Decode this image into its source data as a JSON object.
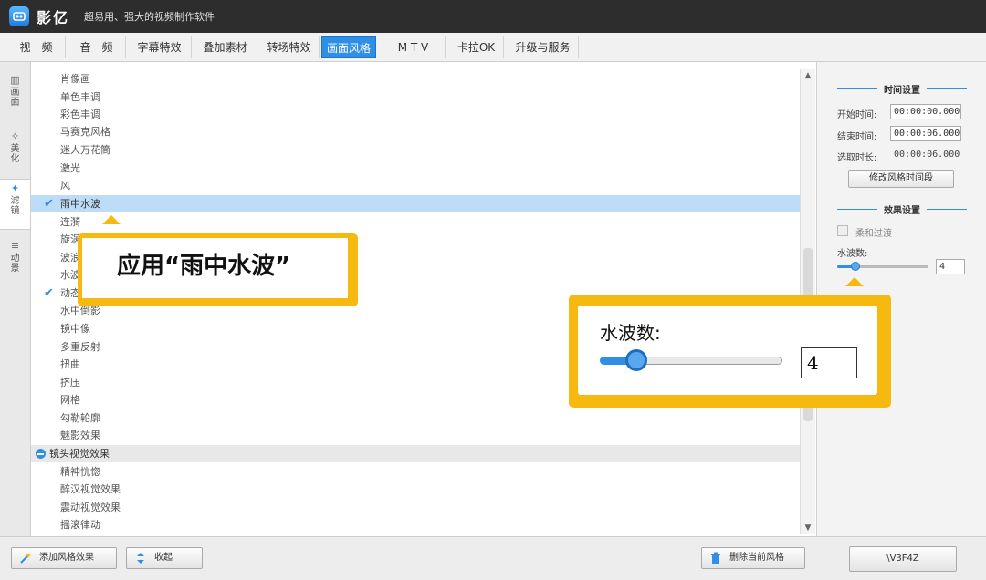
{
  "app": {
    "name": "影亿",
    "slogan": "超易用、强大的视频制作软件"
  },
  "menu": {
    "tabs": [
      {
        "label": "视　频"
      },
      {
        "label": "音　频"
      },
      {
        "label": "字幕特效"
      },
      {
        "label": "叠加素材"
      },
      {
        "label": "转场特效"
      },
      {
        "label": "画面风格",
        "active": true
      },
      {
        "label": "M T V"
      },
      {
        "label": "卡拉OK"
      },
      {
        "label": "升级与服务"
      }
    ]
  },
  "leftnav": {
    "items": [
      {
        "label": "画面",
        "icon": "film-icon"
      },
      {
        "label": "美化",
        "icon": "wand-icon"
      },
      {
        "label": "滤镜",
        "icon": "magic-wand-icon",
        "active": true
      },
      {
        "label": "动景",
        "icon": "layers-icon"
      }
    ]
  },
  "list": {
    "items": [
      {
        "label": "肖像画"
      },
      {
        "label": "单色丰调"
      },
      {
        "label": "彩色丰调"
      },
      {
        "label": "马赛克风格"
      },
      {
        "label": "迷人万花筒"
      },
      {
        "label": "激光"
      },
      {
        "label": "风"
      },
      {
        "label": "雨中水波",
        "checked": true,
        "selected": true
      },
      {
        "label": "连漪"
      },
      {
        "label": "旋涡"
      },
      {
        "label": "波浪"
      },
      {
        "label": "水波"
      },
      {
        "label": "动态",
        "checked": true
      },
      {
        "label": "水中倒影"
      },
      {
        "label": "镜中像"
      },
      {
        "label": "多重反射"
      },
      {
        "label": "扭曲"
      },
      {
        "label": "挤压"
      },
      {
        "label": "网格"
      },
      {
        "label": "勾勒轮廓"
      },
      {
        "label": "魅影效果"
      }
    ],
    "group": {
      "label": "镜头视觉效果"
    },
    "group_items": [
      {
        "label": "精神恍惚"
      },
      {
        "label": "醉汉视觉效果"
      },
      {
        "label": "震动视觉效果"
      },
      {
        "label": "摇滚律动"
      }
    ]
  },
  "right_panel": {
    "time_section_title": "时间设置",
    "start_label": "开始时间:",
    "start_value": "00:00:00.000",
    "end_label": "结束时间:",
    "end_value": "00:00:06.000",
    "duration_label": "选取时长:",
    "duration_value": "00:00:06.000",
    "modify_button": "修改风格时间段",
    "effect_section_title": "效果设置",
    "soft_transition_label": "柔和过渡",
    "ripple_label": "水波数:",
    "ripple_value": "4",
    "ripple_fraction": 0.2
  },
  "bottom": {
    "add_style_button": "添加风格效果",
    "collapse_button": "收起",
    "delete_style_button": "删除当前风格",
    "right_button": "\\V3F4Z"
  },
  "callouts": {
    "apply_text": "应用“雨中水波”",
    "zoom_label": "水波数:",
    "zoom_value": "4"
  },
  "colors": {
    "accent": "#2f8fe6",
    "callout": "#f6b910",
    "titlebar": "#2d2d2d",
    "selection": "#bcdcf7"
  }
}
